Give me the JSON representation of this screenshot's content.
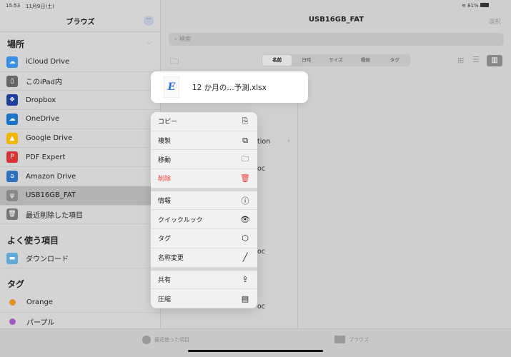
{
  "status": {
    "time": "15:53",
    "date": "11月9日(土)",
    "battery": "81%"
  },
  "sidebar": {
    "title": "ブラウズ",
    "locations_header": "場所",
    "locations": [
      {
        "label": "iCloud Drive",
        "icon": "icloud-icon",
        "color": "#3a8ee6"
      },
      {
        "label": "このiPad内",
        "icon": "ipad-icon",
        "color": "#666666"
      },
      {
        "label": "Dropbox",
        "icon": "dropbox-icon",
        "color": "#1b3f9a"
      },
      {
        "label": "OneDrive",
        "icon": "onedrive-icon",
        "color": "#1a73c8"
      },
      {
        "label": "Google Drive",
        "icon": "google-drive-icon",
        "color": "#f4b400"
      },
      {
        "label": "PDF Expert",
        "icon": "pdf-expert-icon",
        "color": "#d93434"
      },
      {
        "label": "Amazon Drive",
        "icon": "amazon-drive-icon",
        "color": "#2f6fbf"
      },
      {
        "label": "USB16GB_FAT",
        "icon": "usb-icon",
        "color": "#888888"
      },
      {
        "label": "最近削除した項目",
        "icon": "trash-icon",
        "color": "#777777"
      }
    ],
    "favorites_header": "よく使う項目",
    "favorites": [
      {
        "label": "ダウンロード",
        "icon": "folder-icon"
      }
    ],
    "tags_header": "タグ",
    "tags": [
      {
        "label": "Orange",
        "color": "#e8901a"
      },
      {
        "label": "パープル",
        "color": "#a35ac8"
      }
    ]
  },
  "main": {
    "title": "USB16GB_FAT",
    "select": "選択",
    "search_placeholder": "検索",
    "sort": [
      "名前",
      "日時",
      "サイズ",
      "種類",
      "タグ"
    ],
    "active_sort": "名前",
    "fragments": [
      "tion",
      "oc",
      "oc",
      "oc"
    ]
  },
  "preview": {
    "filename": "12 か月の…予測.xlsx"
  },
  "menu": {
    "groups": [
      [
        {
          "label": "コピー",
          "icon": "copy-icon",
          "glyph": "⎘"
        },
        {
          "label": "複製",
          "icon": "duplicate-icon",
          "glyph": "⧉"
        },
        {
          "label": "移動",
          "icon": "folder-icon",
          "glyph": "🗀"
        },
        {
          "label": "削除",
          "icon": "trash-icon",
          "glyph": "🗑",
          "destructive": true
        }
      ],
      [
        {
          "label": "情報",
          "icon": "info-icon",
          "glyph": "ⓘ"
        },
        {
          "label": "クイックルック",
          "icon": "eye-icon",
          "glyph": "👁"
        },
        {
          "label": "タグ",
          "icon": "tag-icon",
          "glyph": "⬡"
        },
        {
          "label": "名称変更",
          "icon": "pencil-icon",
          "glyph": "╱"
        }
      ],
      [
        {
          "label": "共有",
          "icon": "share-icon",
          "glyph": "⇪"
        },
        {
          "label": "圧縮",
          "icon": "archive-icon",
          "glyph": "▤"
        }
      ]
    ]
  },
  "tabbar": {
    "recents": "最近使った項目",
    "browse": "ブラウズ"
  }
}
